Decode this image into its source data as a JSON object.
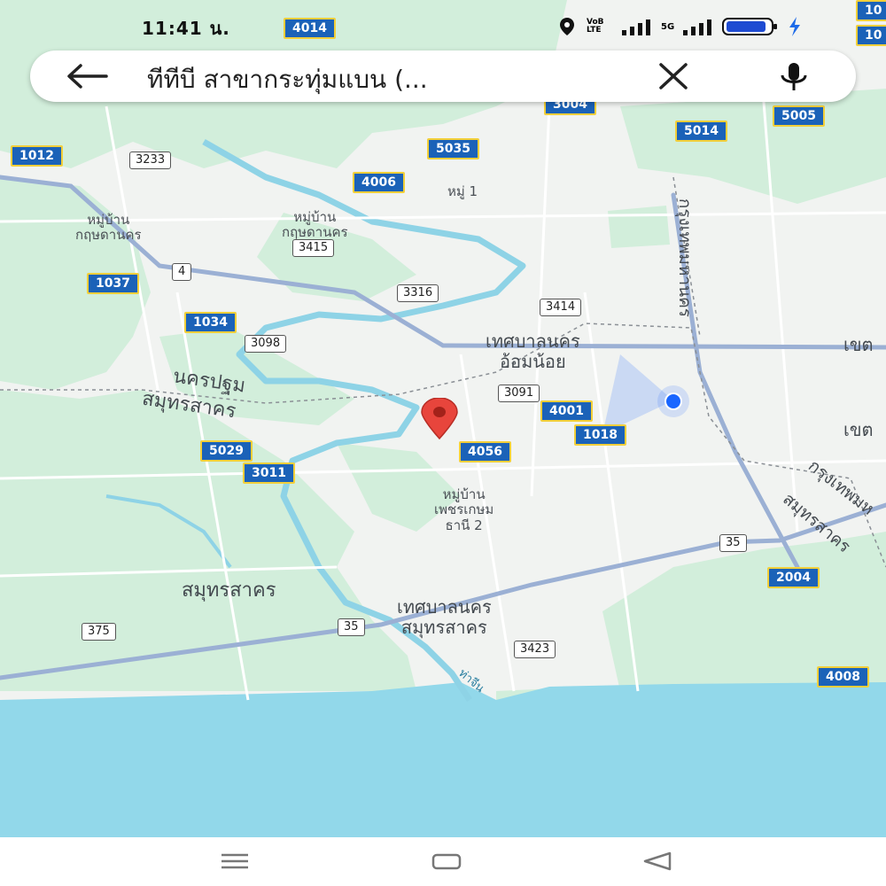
{
  "status_bar": {
    "time": "11:41 น.",
    "volte": "VoB LTE",
    "network": "5G"
  },
  "search": {
    "query": "ทีทีบี สาขากระทุ่มแบน (..."
  },
  "map": {
    "areas": [
      {
        "id": "moo-1",
        "text": "หมู่ 1"
      },
      {
        "id": "krisadanakorn-1",
        "lines": [
          "หมู่บ้าน",
          "กฤษดานคร"
        ]
      },
      {
        "id": "krisadanakorn-2",
        "lines": [
          "หมู่บ้าน",
          "กฤษดานคร"
        ]
      },
      {
        "id": "om-noi",
        "lines": [
          "เทศบาลนคร",
          "อ้อมน้อย"
        ]
      },
      {
        "id": "nakhon-pathom",
        "text": "นครปฐม"
      },
      {
        "id": "samut-sakhon-prov",
        "text": "สมุทรสาคร"
      },
      {
        "id": "phetkasem-2",
        "lines": [
          "หมู่บ้าน",
          "เพชรเกษม",
          "ธานี 2"
        ]
      },
      {
        "id": "samut-sakhon",
        "text": "สมุทรสาคร"
      },
      {
        "id": "samut-sakhon-city",
        "lines": [
          "เทศบาลนคร",
          "สมุทรสาคร"
        ]
      },
      {
        "id": "khet-1",
        "text": "เขต"
      },
      {
        "id": "khet-2",
        "text": "เขต"
      },
      {
        "id": "bangkok-1",
        "text": "กรุงเทพมหานคร"
      },
      {
        "id": "bangkok-2",
        "text": "กรุงเทพมห"
      },
      {
        "id": "samut-sakhon-rot",
        "text": "สมุทรสาคร"
      },
      {
        "id": "tha-chin",
        "text": "ท่าจีน"
      }
    ],
    "yellow_shields": [
      "4014",
      "1012",
      "5035",
      "4006",
      "1037",
      "1034",
      "4001",
      "1018",
      "5029",
      "3011",
      "4056",
      "5014",
      "5005",
      "3004",
      "2004",
      "4008",
      "10",
      "10"
    ],
    "white_shields": [
      "3233",
      "4",
      "3415",
      "3316",
      "3414",
      "3098",
      "3091",
      "35",
      "35",
      "375",
      "3423"
    ]
  },
  "colors": {
    "land": "#f1f3f1",
    "green": "#d2eedb",
    "water": "#92d8ea",
    "river": "#8ed3e6",
    "highway": "#9bb0d4",
    "pin": "#e8453c",
    "location_dot": "#1a66ff"
  },
  "icons": {
    "back": "arrow-left-icon",
    "close": "close-icon",
    "mic": "microphone-icon",
    "pin": "map-pin-icon",
    "location": "current-location-icon"
  }
}
